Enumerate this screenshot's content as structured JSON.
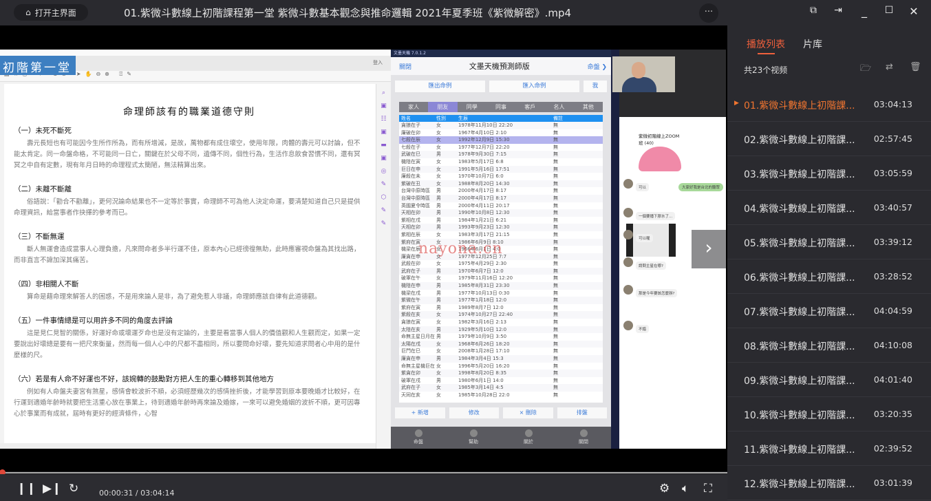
{
  "topbar": {
    "home_label": "打开主界面",
    "title": "01.紫微斗數線上初階課程第一堂  紫微斗數基本觀念與推命邏輯  2021年夏季班《紫微解密》.mp4",
    "more_label": "···"
  },
  "video": {
    "doc": {
      "banner": "初階第一堂",
      "signin": "登入",
      "title": "命理師該有的職業道德守則",
      "sections": [
        {
          "heading": "（一）未死不斷死",
          "body": "壽元長短也有可能因今生所作所為，而有所增減，是故，萬物都有成住壞空，使用年限，肉體的壽元可以討論，但不能太肯定。同一命盤命格，不可能同一日亡，關鍵在於父母不同，遺傳不同，個性行為，生活作息飲食習慣不同，還有冥冥之中自有定數，現有年月日時的命理程式太簡陋，無法精算出來。"
        },
        {
          "heading": "（二）未離不斷離",
          "body": "俗語說：「勸合不勸離」，更何況論命結果也不一定等於事實，命理師不可為他人決定命運，要清楚知道自己只是提供命理資訊，給當事者作抉擇的參考而已。"
        },
        {
          "heading": "（三）不斷無運",
          "body": "斷人無運會造成當事人心理負擔，凡來問命者多半行運不佳，原本內心已經徬徨無助，此時應審視命盤為其找出路，而非直言不諱加深其痛苦。"
        },
        {
          "heading": "（四）非相關人不斷",
          "body": "算命是藉命理來解答人的困惑，不是用來論人是非，為了避免惹人非議，命理師應該自律有此道德觀。"
        },
        {
          "heading": "（五）一件事情總是可以用許多不同的角度去評論",
          "body": "這是見仁見智的關係，好運好命或壞運歹命也是沒有定論的，主要是看當事人個人的價值觀和人生觀而定，如果一定要說出好壞總是要有一把尺來衡量，然而每一個人心中的尺都不盡相同，所以要問命好壞，要先知道求問者心中用的是什麼樣的尺。"
        },
        {
          "heading": "（六）若是有人命不好運也不好，該婉轉的鼓勵對方把人生的重心轉移到其他地方",
          "body": "例如有人命盤夫妻宮有煞星，感情會較波折不順，必須經歷幾次的感情挫折後，才能學習到原本要晚婚才比較好，在行運到適婚年齡時就要把生活重心放在事業上，待到適婚年齡時再來論及婚嫁，一來可以避免婚姻的波折不順，更可因專心於事業而有成就，屆時有更好的經濟條件，心智"
        }
      ]
    },
    "app": {
      "window_title": "文墨天機 7.0.1.2",
      "close_label": "關閉",
      "header_title": "文墨天機預測師版",
      "chart_label": "命盤",
      "export_label": "匯出命例",
      "import_label": "匯入命例",
      "me_label": "我",
      "categories": [
        "家人",
        "朋友",
        "同學",
        "同事",
        "客戶",
        "名人",
        "其他"
      ],
      "selected_category": "朋友",
      "columns": [
        "姓名",
        "性別",
        "生辰",
        "備註"
      ],
      "rows": [
        [
          "貪狼在子",
          "女",
          "1978年11月10日 22:20",
          "無"
        ],
        [
          "廉破在卯",
          "女",
          "1967年4月10日 2:10",
          "無"
        ],
        [
          "七殺在辰",
          "女",
          "1992年12月9日 15:30",
          "無"
        ],
        [
          "七殺在子",
          "女",
          "1977年12月7日 22:20",
          "無"
        ],
        [
          "武破在巳",
          "男",
          "1978年9月30日 7:15",
          "無"
        ],
        [
          "機陰在寅",
          "女",
          "1983年5月17日 6:8",
          "無"
        ],
        [
          "巨日在申",
          "女",
          "1991年5月16日 17:51",
          "無"
        ],
        [
          "廉殺在未",
          "女",
          "1970年10月7日 6:0",
          "無"
        ],
        [
          "紫破在丑",
          "女",
          "1988年8月20日 14:30",
          "無"
        ],
        [
          "台灣中原時區",
          "男",
          "2000年4月17日 8:17",
          "無"
        ],
        [
          "台灣中原時區",
          "男",
          "2000年4月17日 8:17",
          "無"
        ],
        [
          "英國夏令時區",
          "男",
          "2000年4月11日 20:17",
          "無"
        ],
        [
          "天相在卯",
          "男",
          "1990年10月8日 12:30",
          "無"
        ],
        [
          "紫相在戌",
          "男",
          "1984年1月21日 6:21",
          "無"
        ],
        [
          "天相在卯",
          "男",
          "1993年9月23日 12:30",
          "無"
        ],
        [
          "紫相在辰",
          "女",
          "1983年3月17日 21:15",
          "無"
        ],
        [
          "紫府在寅",
          "女",
          "1986年6月9日 8:10",
          "無"
        ],
        [
          "機梁在辰",
          "女",
          "1966年6月1日 4:0",
          "無"
        ],
        [
          "廉貪在申",
          "女",
          "1977年12月25日 7:7",
          "無"
        ],
        [
          "武殺在卯",
          "女",
          "1975年4月29日 2:30",
          "無"
        ],
        [
          "武府在子",
          "男",
          "1970年6月7日 12:0",
          "無"
        ],
        [
          "破軍在午",
          "女",
          "1979年11月16日 12:20",
          "無"
        ],
        [
          "機陰在申",
          "男",
          "1985年8月31日 23:30",
          "無"
        ],
        [
          "機梁在戌",
          "男",
          "1977年10月13日 0:30",
          "無"
        ],
        [
          "紫微在午",
          "男",
          "1977年1月18日 12:0",
          "無"
        ],
        [
          "紫府在寅",
          "男",
          "1989年8月7日 12:0",
          "無"
        ],
        [
          "紫殺在亥",
          "女",
          "1974年10月27日 22:40",
          "無"
        ],
        [
          "貪狼在寅",
          "女",
          "1982年3月16日 2:13",
          "無"
        ],
        [
          "太陰在亥",
          "男",
          "1929年5月10日 12:0",
          "無"
        ],
        [
          "命無主星日月在",
          "男",
          "1979年10月9日 3:50",
          "無"
        ],
        [
          "太陽在戌",
          "女",
          "1968年6月26日 18:20",
          "無"
        ],
        [
          "巨門在巳",
          "女",
          "2008年1月28日 17:10",
          "無"
        ],
        [
          "廉貪在申",
          "男",
          "1984年3月4日 15:3",
          "無"
        ],
        [
          "命無主星機巨在",
          "女",
          "1996年5月20日 16:20",
          "無"
        ],
        [
          "紫貪在卯",
          "女",
          "1998年8月20日 8:35",
          "無"
        ],
        [
          "破軍在戌",
          "男",
          "1980年6月1日 14:0",
          "無"
        ],
        [
          "武府在子",
          "女",
          "1985年3月14日 4:5",
          "無"
        ],
        [
          "天同在亥",
          "女",
          "1985年10月28日 22:0",
          "無"
        ]
      ],
      "selected_row": 2,
      "actions": [
        "+ 新增",
        "修改",
        "× 刪除",
        "排盤"
      ],
      "nav": [
        "命盤",
        "幫助",
        "關於",
        "關閉"
      ]
    },
    "watermark": "nayona.cn",
    "chat": {
      "group_title": "紫微初階線上ZOOM班 (40)",
      "green_bubble": "大家好我是台北的聽眾",
      "messages": [
        {
          "text": "可以"
        },
        {
          "text": "一個要播下膠水了..."
        },
        {
          "text": "可以喔"
        },
        {
          "text": "請問主星在哪?"
        },
        {
          "text": "那是今年要該怎麼辦?"
        },
        {
          "text": "不錯"
        }
      ]
    }
  },
  "controls": {
    "current_time": "00:00:31",
    "total_time": "03:04:14",
    "progress_fraction": 0.003
  },
  "playlist": {
    "tabs": [
      "播放列表",
      "片库"
    ],
    "active_tab": "播放列表",
    "count_label": "共23个视频",
    "accent": "#f07530",
    "items": [
      {
        "title": "01.紫微斗數線上初階課...",
        "duration": "03:04:13"
      },
      {
        "title": "02.紫微斗數線上初階課...",
        "duration": "02:57:45"
      },
      {
        "title": "03.紫微斗數線上初階課...",
        "duration": "03:05:59"
      },
      {
        "title": "04.紫微斗數線上初階課...",
        "duration": "03:40:57"
      },
      {
        "title": "05.紫微斗數線上初階課...",
        "duration": "03:39:12"
      },
      {
        "title": "06.紫微斗數線上初階課...",
        "duration": "03:28:52"
      },
      {
        "title": "07.紫微斗數線上初階課...",
        "duration": "04:04:59"
      },
      {
        "title": "08.紫微斗數線上初階課...",
        "duration": "04:10:08"
      },
      {
        "title": "09.紫微斗數線上初階課...",
        "duration": "04:01:40"
      },
      {
        "title": "10.紫微斗數線上初階課...",
        "duration": "03:20:35"
      },
      {
        "title": "11.紫微斗數線上初階課...",
        "duration": "02:39:52"
      },
      {
        "title": "12.紫微斗數線上初階課...",
        "duration": "03:01:39"
      }
    ]
  }
}
